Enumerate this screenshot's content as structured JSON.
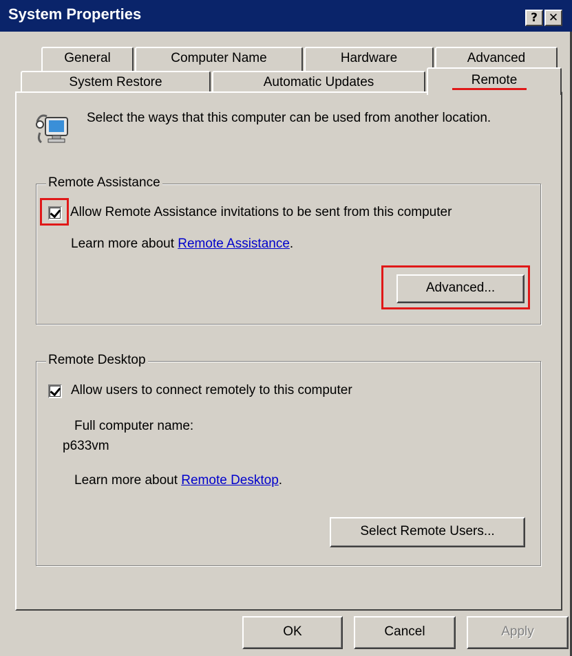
{
  "window": {
    "title": "System Properties",
    "help_button": "?",
    "close_button": "✕"
  },
  "tabs": {
    "row_back": [
      "General",
      "Computer Name",
      "Hardware",
      "Advanced"
    ],
    "row_front": [
      "System Restore",
      "Automatic Updates",
      "Remote"
    ],
    "active": "Remote"
  },
  "intro": {
    "icon": "computer-network-icon",
    "text": "Select the ways that this computer can be used from another location."
  },
  "remote_assistance": {
    "legend": "Remote Assistance",
    "checkbox_label": "Allow Remote Assistance invitations to be sent from this computer",
    "checked": true,
    "learn_more_prefix": "Learn more about ",
    "learn_more_link": "Remote Assistance",
    "learn_more_suffix": ".",
    "advanced_button": "Advanced..."
  },
  "remote_desktop": {
    "legend": "Remote Desktop",
    "checkbox_label": "Allow users to connect remotely to this computer",
    "checked": true,
    "computer_name_label": "Full computer name:",
    "computer_name_value": "p633vm",
    "learn_more_prefix": "Learn more about ",
    "learn_more_link": "Remote Desktop",
    "learn_more_suffix": ".",
    "select_users_button": "Select Remote Users..."
  },
  "footer": {
    "ok": "OK",
    "cancel": "Cancel",
    "apply": "Apply"
  },
  "colors": {
    "title_bar": "#0a246a",
    "face": "#d4d0c8",
    "highlight_annotation": "#e01818",
    "link": "#0000cc"
  }
}
